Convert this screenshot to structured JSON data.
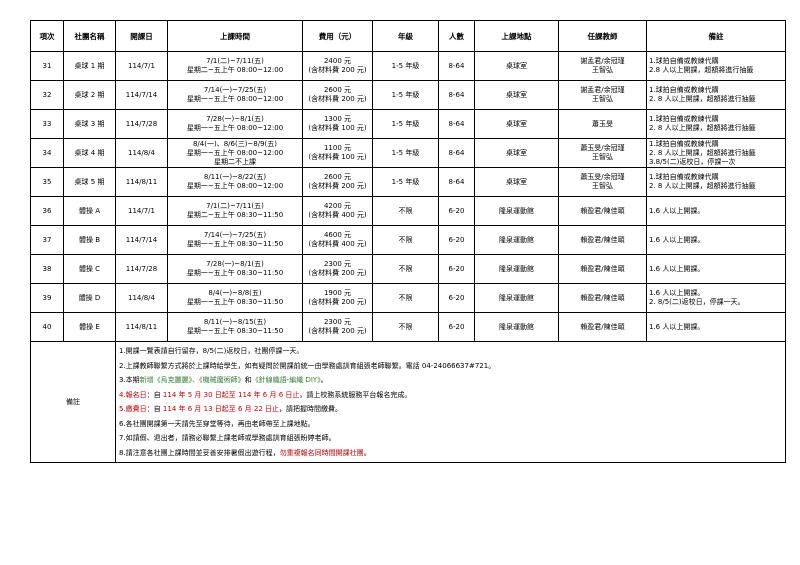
{
  "headers": [
    "項次",
    "社團名稱",
    "開課日",
    "上課時間",
    "費用（元）",
    "年級",
    "人數",
    "上課地點",
    "任課教師",
    "備註"
  ],
  "rows": [
    {
      "no": "31",
      "name": "桌球 1 期",
      "start": "114/7/1",
      "time": [
        "7/1(二)~7/11(五)",
        "星期二~五上午 08:00~12:00"
      ],
      "fee": [
        "2400 元",
        "(含材料費 200 元)"
      ],
      "grade": "1-5 年級",
      "count": "8-64",
      "place": "桌球室",
      "teacher": [
        "謝孟君/余冠瑾",
        "王智弘"
      ],
      "note": [
        "1.球拍自備或教練代購",
        "2.8 人以上開課，超額將進行抽籤"
      ]
    },
    {
      "no": "32",
      "name": "桌球 2 期",
      "start": "114/7/14",
      "time": [
        "7/14(一)~7/25(五)",
        "星期一~五上午 08:00~12:00"
      ],
      "fee": [
        "2600 元",
        "(含材料費 200 元)"
      ],
      "grade": "1-5 年級",
      "count": "8-64",
      "place": "桌球室",
      "teacher": [
        "謝孟君/余冠瑾",
        "王智弘"
      ],
      "note": [
        "1.球拍自備或教練代購",
        "2. 8 人以上開課，超額將進行抽籤"
      ]
    },
    {
      "no": "33",
      "name": "桌球 3 期",
      "start": "114/7/28",
      "time": [
        "7/28(一)~8/1(五)",
        "星期一~五上午 08:00~12:00"
      ],
      "fee": [
        "1300 元",
        "(含材料費 100 元)"
      ],
      "grade": "1-5 年級",
      "count": "8-64",
      "place": "桌球室",
      "teacher": [
        "蕭玉旻"
      ],
      "note": [
        "1.球拍自備或教練代購",
        "2. 8 人以上開課，超額將進行抽籤"
      ]
    },
    {
      "no": "34",
      "name": "桌球 4 期",
      "start": "114/8/4",
      "time": [
        "8/4(一)、8/6(三)~8/9(五)",
        "星期一~五上午 08:00~12:00",
        "星期二不上課"
      ],
      "fee": [
        "1100 元",
        "(含材料費 100 元)"
      ],
      "grade": "1-5 年級",
      "count": "8-64",
      "place": "桌球室",
      "teacher": [
        "蕭玉旻/余冠瑾",
        "王智弘"
      ],
      "note": [
        "1.球拍自備或教練代購",
        "2. 8 人以上開課，超額將進行抽籤",
        "3.8/5(二)返校日，停課一次"
      ]
    },
    {
      "no": "35",
      "name": "桌球 5 期",
      "start": "114/8/11",
      "time": [
        "8/11(一)~8/22(五)",
        "星期一~五上午 08:00~12:00"
      ],
      "fee": [
        "2600 元",
        "(含材料費 200 元)"
      ],
      "grade": "1-5 年級",
      "count": "8-64",
      "place": "桌球室",
      "teacher": [
        "蕭玉旻/余冠瑾",
        "王智弘"
      ],
      "note": [
        "1.球拍自備或教練代購",
        "2. 8 人以上開課，超額將進行抽籤"
      ]
    },
    {
      "no": "36",
      "name": "體操 A",
      "start": "114/7/1",
      "time": [
        "7/1(二)~7/11(五)",
        "星期二~五上午 08:30~11:50"
      ],
      "fee": [
        "4200 元",
        "(含材料費 400 元)"
      ],
      "grade": "不限",
      "count": "6-20",
      "place": "隆泉運動館",
      "teacher": [
        "賴盈君/陳佳頤"
      ],
      "note": [
        "1.6 人以上開課。"
      ]
    },
    {
      "no": "37",
      "name": "體操 B",
      "start": "114/7/14",
      "time": [
        "7/14(一)~7/25(五)",
        "星期一~五上午 08:30~11:50"
      ],
      "fee": [
        "4600 元",
        "(含材料費 400 元)"
      ],
      "grade": "不限",
      "count": "6-20",
      "place": "隆泉運動館",
      "teacher": [
        "賴盈君/陳佳頤"
      ],
      "note": [
        "1.6 人以上開課。"
      ]
    },
    {
      "no": "38",
      "name": "體操 C",
      "start": "114/7/28",
      "time": [
        "7/28(一)~8/1(五)",
        "星期一~五上午 08:30~11:50"
      ],
      "fee": [
        "2300 元",
        "(含材料費 200 元)"
      ],
      "grade": "不限",
      "count": "6-20",
      "place": "隆泉運動館",
      "teacher": [
        "賴盈君/陳佳頤"
      ],
      "note": [
        "1.6 人以上開課。"
      ]
    },
    {
      "no": "39",
      "name": "體操 D",
      "start": "114/8/4",
      "time": [
        "8/4(一)~8/8(五)",
        "星期一~五上午 08:30~11:50"
      ],
      "fee": [
        "1900 元",
        "(含材料費 200 元)"
      ],
      "grade": "不限",
      "count": "6-20",
      "place": "隆泉運動館",
      "teacher": [
        "賴盈君/陳佳頤"
      ],
      "note": [
        "1.6 人以上開課。",
        "2. 8/5(二)返校日，停課一天。"
      ]
    },
    {
      "no": "40",
      "name": "體操 E",
      "start": "114/8/11",
      "time": [
        "8/11(一)~8/15(五)",
        "星期一~五上午 08:30~11:50"
      ],
      "fee": [
        "2300 元",
        "(含材料費 200 元)"
      ],
      "grade": "不限",
      "count": "6-20",
      "place": "隆泉運動館",
      "teacher": [
        "賴盈君/陳佳頤"
      ],
      "note": [
        "1.6 人以上開課。"
      ]
    }
  ],
  "remarks_label": "備註",
  "remarks": [
    [
      {
        "t": "1.開課一覽表請自行留存，8/5(二)返校日，社團停課一天。"
      }
    ],
    [
      {
        "t": "2.上課教師聯繫方式將於上課時給學生，如有疑問於開課前統一由學務處訓育組張老師聯繫。電話 04-24066637#721。"
      }
    ],
    [
      {
        "t": "3.本期"
      },
      {
        "t": "新增《烏克麗麗》、《機械魔術師》",
        "c": "green"
      },
      {
        "t": "和"
      },
      {
        "t": "《針線織語-編織 DIY》",
        "c": "green"
      },
      {
        "t": "。"
      }
    ],
    [
      {
        "t": "4.報名日",
        "c": "red"
      },
      {
        "t": "：自 "
      },
      {
        "t": "114 年 5 月 30 日起至 114 年 6 月 6 日止",
        "c": "red"
      },
      {
        "t": "，請上校務系統服務平台報名完成。"
      }
    ],
    [
      {
        "t": "5.繳費日",
        "c": "red"
      },
      {
        "t": "：自 "
      },
      {
        "t": "114 年 6 月 13 日起至 6 月 22 日止",
        "c": "red"
      },
      {
        "t": "，請把握時間繳費。"
      }
    ],
    [
      {
        "t": "6.各社團開課第一天請先至穿堂等待，再由老師帶至上課地點。"
      }
    ],
    [
      {
        "t": "7.如請假、退出者，請務必聯繫上課老師或學務處訓育組張盼婷老師。"
      }
    ],
    [
      {
        "t": "8.請注意各社團上課時間並妥善安排暑假出遊行程，"
      },
      {
        "t": "勿重複報名同時間開課社團",
        "c": "red"
      },
      {
        "t": "。"
      }
    ]
  ]
}
